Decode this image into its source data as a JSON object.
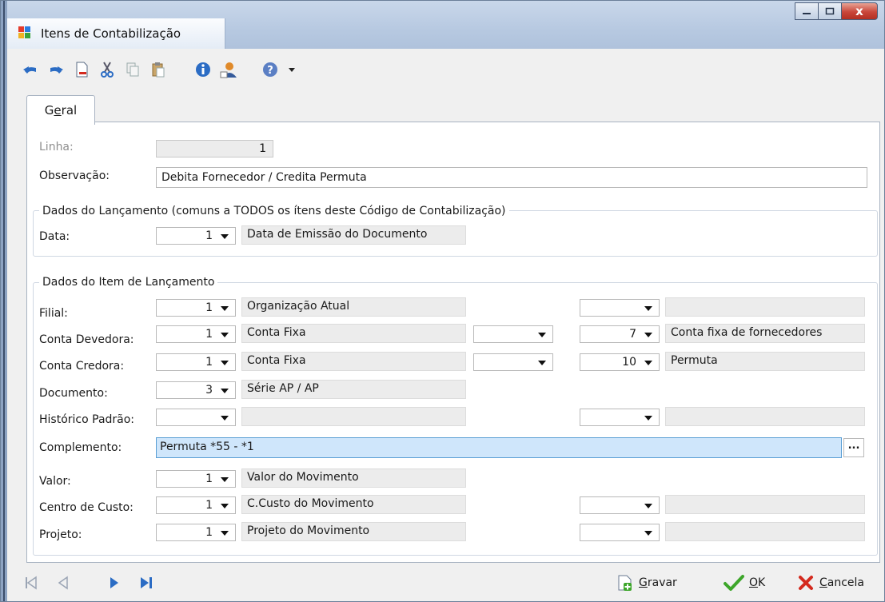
{
  "window": {
    "title": "Itens de Contabilização",
    "close_glyph": "x"
  },
  "tabs": [
    {
      "label_pre": "G",
      "label_u": "e",
      "label_post": "ral"
    }
  ],
  "form": {
    "linha_label": "Linha:",
    "linha_value": "1",
    "observacao_label": "Observação:",
    "observacao_value": "Debita Fornecedor / Credita Permuta"
  },
  "group_lancamento": {
    "title": "Dados do Lançamento (comuns a TODOS os ítens deste Código de Contabilização)",
    "data_label": "Data:",
    "data_value": "1",
    "data_desc": "Data de Emissão do Documento"
  },
  "group_item": {
    "title": "Dados do Item de Lançamento",
    "filial": {
      "label": "Filial:",
      "value": "1",
      "desc": "Organização Atual"
    },
    "conta_devedora": {
      "label": "Conta Devedora:",
      "value": "1",
      "desc": "Conta Fixa",
      "value2": "7",
      "desc2": "Conta fixa de fornecedores"
    },
    "conta_credora": {
      "label": "Conta Credora:",
      "value": "1",
      "desc": "Conta Fixa",
      "value2": "10",
      "desc2": "Permuta"
    },
    "documento": {
      "label": "Documento:",
      "value": "3",
      "desc": "Série AP / AP"
    },
    "historico": {
      "label": "Histórico Padrão:"
    },
    "complemento": {
      "label": "Complemento:",
      "value": "Permuta *55 - *1",
      "button": "..."
    },
    "valor": {
      "label": "Valor:",
      "value": "1",
      "desc": "Valor do Movimento"
    },
    "centro_custo": {
      "label": "Centro de Custo:",
      "value": "1",
      "desc": "C.Custo do Movimento"
    },
    "projeto": {
      "label": "Projeto:",
      "value": "1",
      "desc": "Projeto do Movimento"
    }
  },
  "actions": {
    "gravar_u": "G",
    "gravar_rest": "ravar",
    "ok_u": "O",
    "ok_rest": "K",
    "cancela_u": "C",
    "cancela_rest": "ancela"
  },
  "colors": {
    "accent_blue": "#2b6cc4",
    "ok_green": "#3da62a",
    "cancel_red": "#d42a1e",
    "focus_fill": "#cfe6fb"
  },
  "icons": [
    "undo-icon",
    "redo-icon",
    "new-document-icon",
    "cut-icon",
    "copy-icon",
    "paste-icon",
    "info-icon",
    "user-icon",
    "help-icon",
    "first-record-icon",
    "previous-record-icon",
    "next-record-icon",
    "last-record-icon",
    "save-icon",
    "ok-check-icon",
    "cancel-x-icon"
  ]
}
